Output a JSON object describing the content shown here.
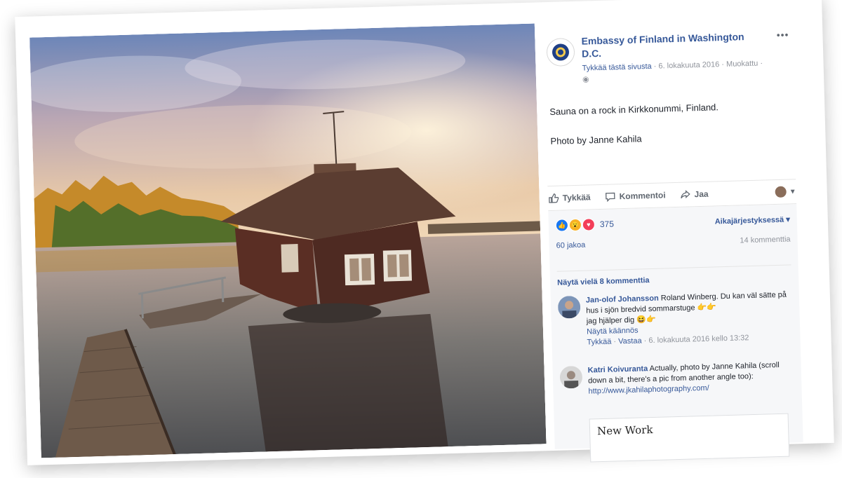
{
  "post": {
    "page_name": "Embassy of Finland in Washington D.C.",
    "meta_like": "Tykkää tästä sivusta",
    "meta_date": "6. lokakuuta 2016",
    "meta_edited": "Muokattu",
    "text_line1": "Sauna on a rock in Kirkkonummi, Finland.",
    "text_line2": "Photo by Janne Kahila"
  },
  "actions": {
    "like": "Tykkää",
    "comment": "Kommentoi",
    "share": "Jaa"
  },
  "stats": {
    "reactions": "375",
    "sort": "Aikajärjestyksessä",
    "shares": "60 jakoa",
    "comments": "14 kommenttia",
    "view_more": "Näytä vielä 8 kommenttia"
  },
  "comments": [
    {
      "author": "Jan-olof Johansson",
      "text_a": " Roland Winberg. Du kan väl sätte på hus i sjön bredvid sommarstuge 👉👉",
      "text_b": "jag hjälper dig 😆👉",
      "translate": "Näytä käännös",
      "like": "Tykkää",
      "reply": "Vastaa",
      "date": "6. lokakuuta 2016 kello 13:32"
    },
    {
      "author": "Katri Koivuranta",
      "text": " Actually, photo by Janne Kahila (scroll down a bit, there's a pic from another angle too): ",
      "link": "http://www.jkahilaphotography.com/"
    }
  ],
  "link_preview": {
    "title": "New Work"
  },
  "icons": {
    "more": "more-dots-icon",
    "like": "thumbs-up-icon",
    "comment": "comment-bubble-icon",
    "share": "share-arrow-icon",
    "dropdown": "chevron-down-icon"
  },
  "colors": {
    "link_blue": "#365899",
    "fb_blue": "#1877f2",
    "meta_gray": "#90949c"
  }
}
